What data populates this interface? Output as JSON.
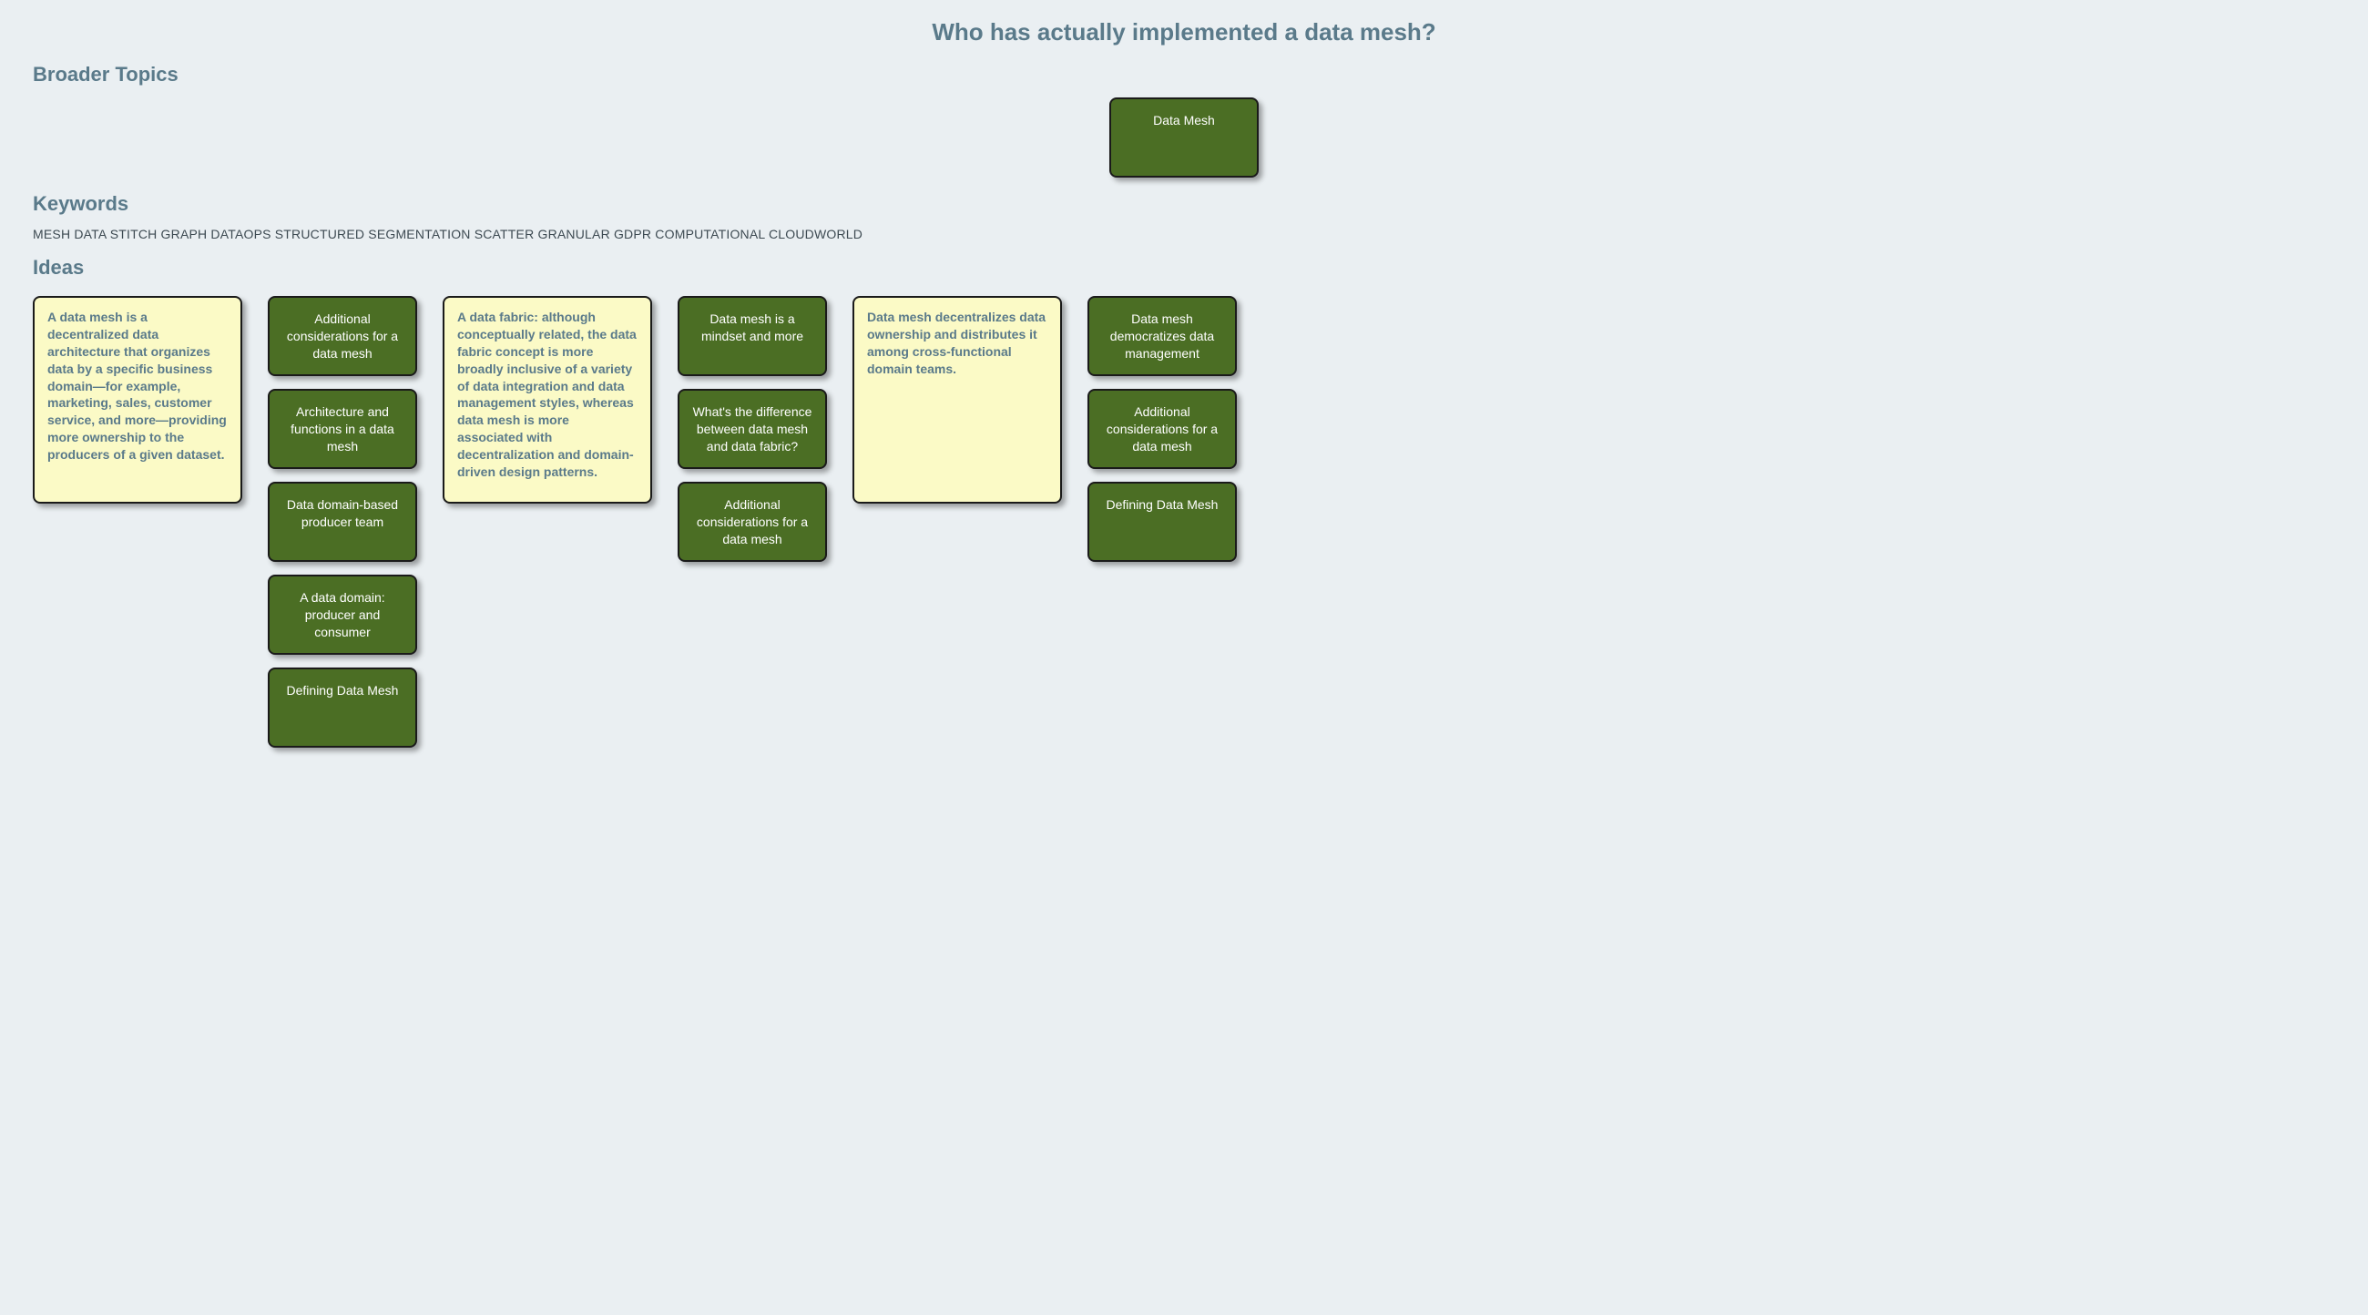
{
  "title": "Who has actually implemented a data mesh?",
  "sections": {
    "broader": "Broader Topics",
    "keywords": "Keywords",
    "ideas": "Ideas"
  },
  "broader_topics": [
    {
      "label": "Data Mesh"
    }
  ],
  "keywords_line": "MESH DATA STITCH GRAPH DATAOPS STRUCTURED SEGMENTATION SCATTER GRANULAR GDPR COMPUTATIONAL CLOUDWORLD",
  "ideas": {
    "group1": {
      "lead": "A data mesh is a decentralized data architecture that organizes data by a specific business domain—for example, marketing, sales, customer service, and more—providing more ownership to the producers of a given dataset.",
      "items": [
        "Additional considerations for a data mesh",
        "Architecture and functions in a data mesh",
        "Data domain-based producer team",
        "A data domain: producer and consumer",
        "Defining Data Mesh"
      ]
    },
    "group2": {
      "lead": "A data fabric: although conceptually related, the data fabric concept is more broadly inclusive of a variety of data integration and data management styles, whereas data mesh is more associated with decentralization and domain-driven design patterns.",
      "items": [
        "Data mesh is a mindset and more",
        "What's the difference between data mesh and data fabric?",
        "Additional considerations for a data mesh"
      ]
    },
    "group3": {
      "lead": "Data mesh decentralizes data ownership and distributes it among cross-functional domain teams.",
      "items": [
        "Data mesh democratizes data management",
        "Additional considerations for a data mesh",
        "Defining Data Mesh"
      ]
    }
  }
}
